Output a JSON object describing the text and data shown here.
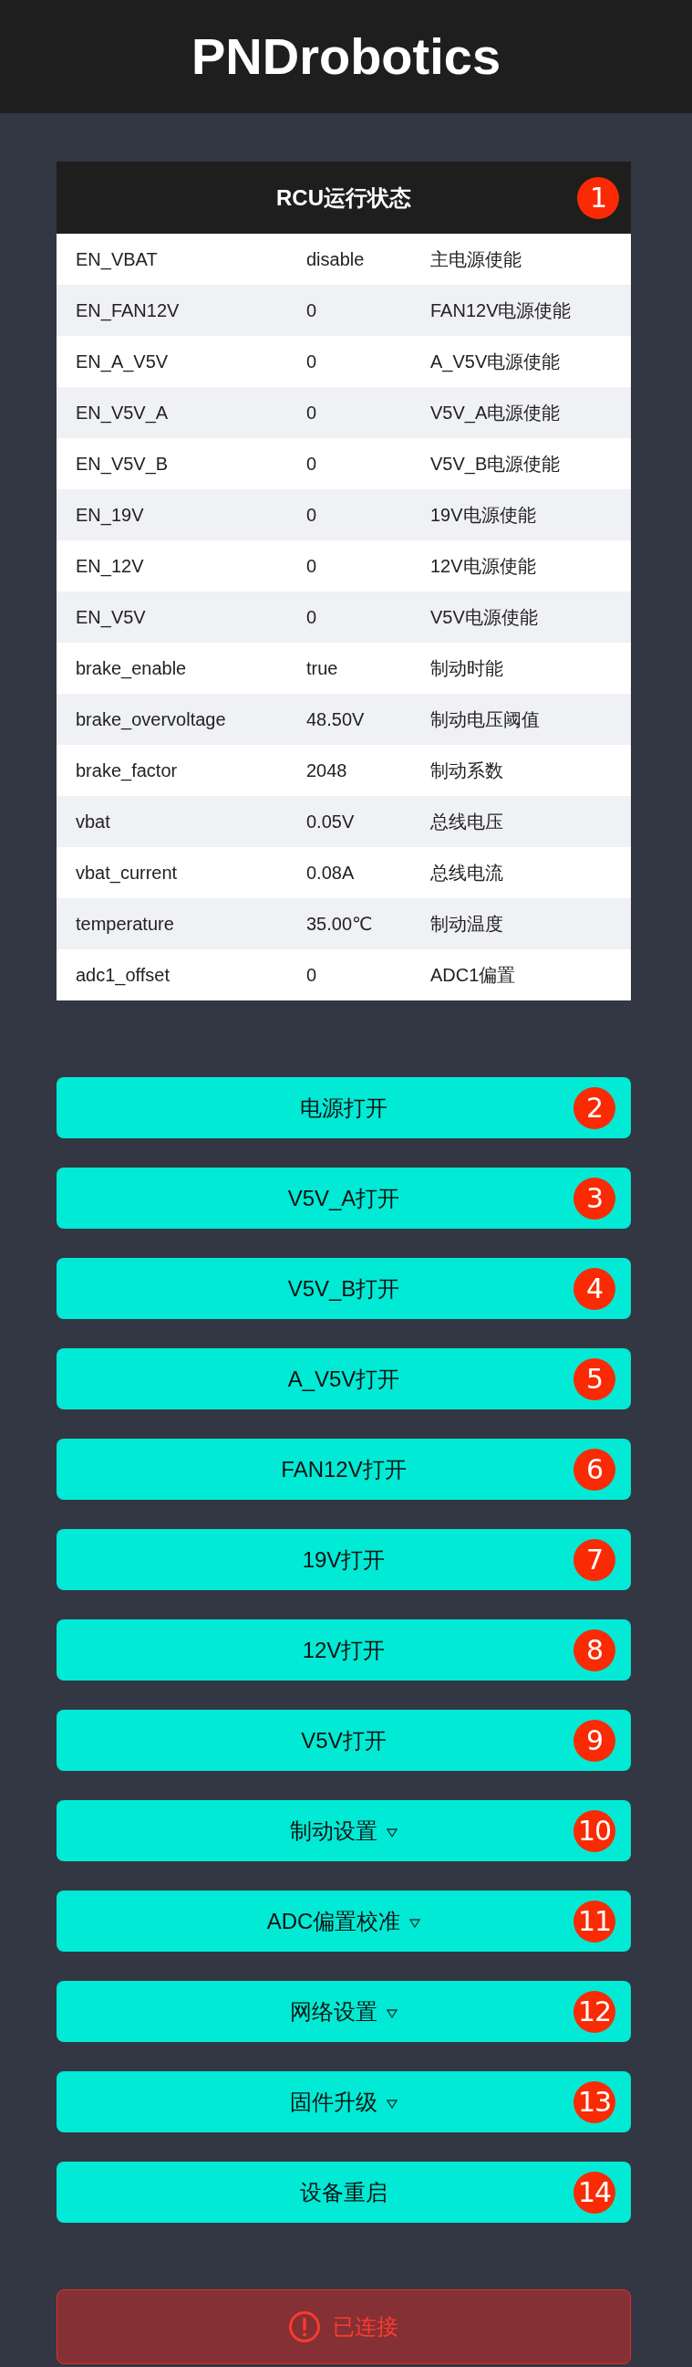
{
  "header": {
    "title": "PNDrobotics"
  },
  "status_table": {
    "title": "RCU运行状态",
    "badge": "1",
    "rows": [
      {
        "name": "EN_VBAT",
        "value": "disable",
        "description": "主电源使能"
      },
      {
        "name": "EN_FAN12V",
        "value": "0",
        "description": "FAN12V电源使能"
      },
      {
        "name": "EN_A_V5V",
        "value": "0",
        "description": "A_V5V电源使能"
      },
      {
        "name": "EN_V5V_A",
        "value": "0",
        "description": "V5V_A电源使能"
      },
      {
        "name": "EN_V5V_B",
        "value": "0",
        "description": "V5V_B电源使能"
      },
      {
        "name": "EN_19V",
        "value": "0",
        "description": "19V电源使能"
      },
      {
        "name": "EN_12V",
        "value": "0",
        "description": "12V电源使能"
      },
      {
        "name": "EN_V5V",
        "value": "0",
        "description": "V5V电源使能"
      },
      {
        "name": "brake_enable",
        "value": "true",
        "description": "制动时能"
      },
      {
        "name": "brake_overvoltage",
        "value": "48.50V",
        "description": "制动电压阈值"
      },
      {
        "name": "brake_factor",
        "value": "2048",
        "description": "制动系数"
      },
      {
        "name": "vbat",
        "value": "0.05V",
        "description": "总线电压"
      },
      {
        "name": "vbat_current",
        "value": "0.08A",
        "description": "总线电流"
      },
      {
        "name": "temperature",
        "value": "35.00℃",
        "description": "制动温度"
      },
      {
        "name": "adc1_offset",
        "value": "0",
        "description": "ADC1偏置"
      }
    ]
  },
  "buttons": [
    {
      "label": "电源打开",
      "badge": "2",
      "kind": "action"
    },
    {
      "label": "V5V_A打开",
      "badge": "3",
      "kind": "action"
    },
    {
      "label": "V5V_B打开",
      "badge": "4",
      "kind": "action"
    },
    {
      "label": "A_V5V打开",
      "badge": "5",
      "kind": "action"
    },
    {
      "label": "FAN12V打开",
      "badge": "6",
      "kind": "action"
    },
    {
      "label": "19V打开",
      "badge": "7",
      "kind": "action"
    },
    {
      "label": "12V打开",
      "badge": "8",
      "kind": "action"
    },
    {
      "label": "V5V打开",
      "badge": "9",
      "kind": "action"
    },
    {
      "label": "制动设置",
      "badge": "10",
      "kind": "menu"
    },
    {
      "label": "ADC偏置校准",
      "badge": "11",
      "kind": "menu"
    },
    {
      "label": "网络设置",
      "badge": "12",
      "kind": "menu"
    },
    {
      "label": "固件升级",
      "badge": "13",
      "kind": "menu"
    },
    {
      "label": "设备重启",
      "badge": "14",
      "kind": "action"
    }
  ],
  "connection_status": {
    "text": "已连接",
    "kind": "error"
  }
}
